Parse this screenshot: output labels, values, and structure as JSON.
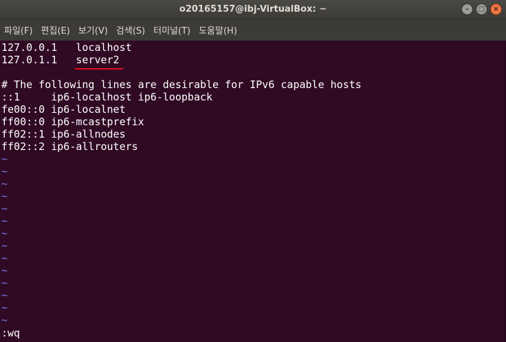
{
  "window": {
    "title": "o20165157@ibj-VirtualBox: ~",
    "minimize_glyph": "–",
    "maximize_glyph": "□",
    "close_glyph": "×"
  },
  "menu": [
    "파일(F)",
    "편집(E)",
    "보기(V)",
    "검색(S)",
    "터미널(T)",
    "도움말(H)"
  ],
  "terminal": {
    "lines": [
      "127.0.0.1   localhost",
      "127.0.1.1   server2",
      "",
      "# The following lines are desirable for IPv6 capable hosts",
      "::1     ip6-localhost ip6-loopback",
      "fe00::0 ip6-localnet",
      "ff00::0 ip6-mcastprefix",
      "ff02::1 ip6-allnodes",
      "ff02::2 ip6-allrouters"
    ],
    "tilde_count": 14,
    "tilde_char": "~",
    "command": ":wq"
  },
  "colors": {
    "background": "#300a24",
    "text": "#ffffff",
    "tilde": "#7d7df0",
    "annotation_underline": "#e0101e"
  }
}
